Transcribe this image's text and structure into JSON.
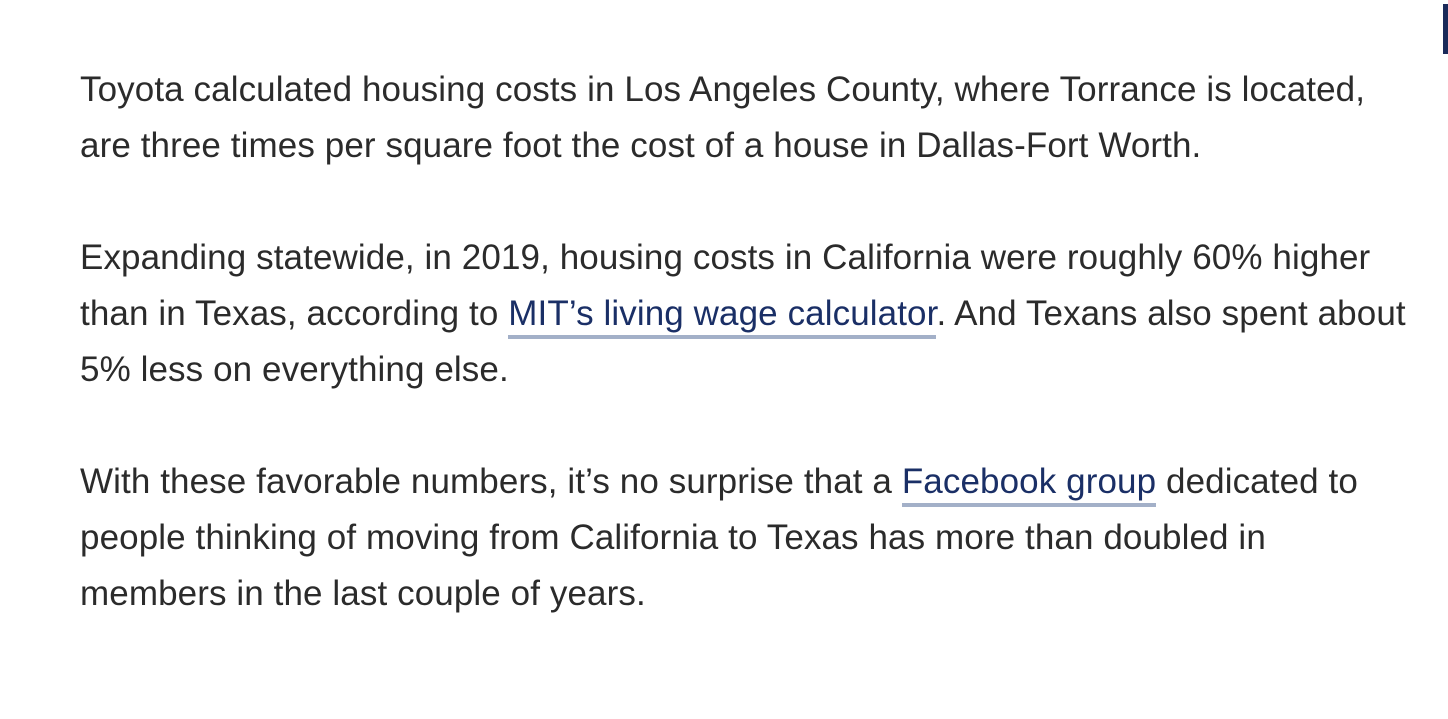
{
  "article": {
    "paragraphs": [
      {
        "text_before": "Toyota calculated housing costs in Los Angeles County, where Torrance is located, are three times per square foot the cost of a house in Dallas-Fort Worth."
      },
      {
        "text_before": "Expanding statewide, in 2019, housing costs in California were roughly 60% higher than in Texas, according to ",
        "link_label": "MIT’s living wage calculator",
        "text_after": ". And Texans also spent about 5% less on everything else."
      },
      {
        "text_before": "With these favorable numbers, it’s no surprise that a ",
        "link_label": "Facebook group",
        "text_after": " dedicated to people thinking of moving from California to Texas has more than doubled in members in the last couple of years."
      }
    ]
  },
  "colors": {
    "text": "#2b2b2b",
    "link": "#1a2f66",
    "link_underline": "#a3b0c8",
    "edge_bar": "#1a2a5a"
  }
}
